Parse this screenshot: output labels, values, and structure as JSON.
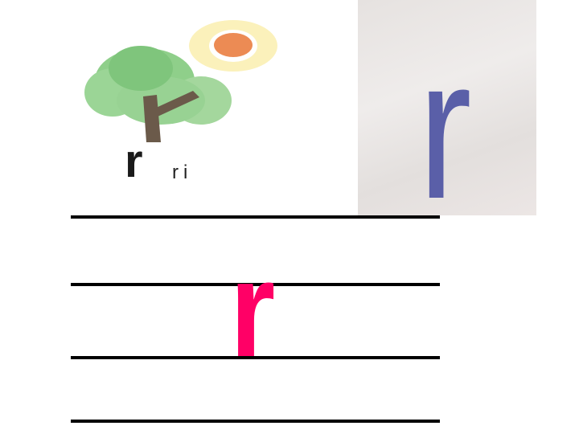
{
  "illustration": {
    "letter": "r",
    "syllable": "ri"
  },
  "card": {
    "letter": "r"
  },
  "writing_practice": {
    "letter": "r"
  },
  "colors": {
    "practice_letter": "#ff0066",
    "card_letter": "#5a5fa8"
  }
}
